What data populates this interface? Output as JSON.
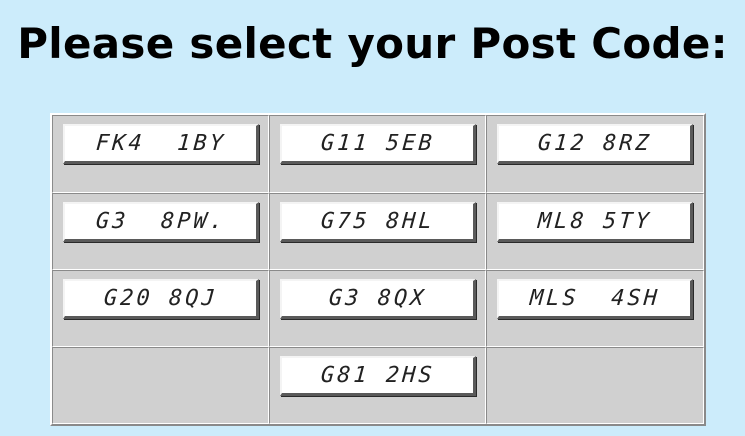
{
  "title": "Please select your Post Code:",
  "postcodes": [
    {
      "label": "FK4  1BY"
    },
    {
      "label": "G11 5EB"
    },
    {
      "label": "G12 8RZ"
    },
    {
      "label": "G3  8PW."
    },
    {
      "label": "G75 8HL"
    },
    {
      "label": "ML8 5TY"
    },
    {
      "label": "G20 8QJ"
    },
    {
      "label": "G3 8QX"
    },
    {
      "label": "MLS  4SH"
    },
    {
      "label": "G81 2HS"
    }
  ]
}
